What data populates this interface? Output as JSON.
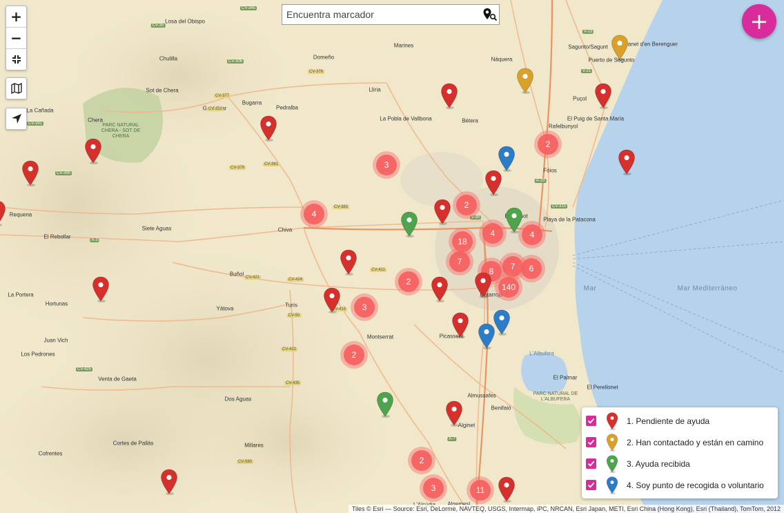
{
  "search": {
    "placeholder": "Encuentra marcador"
  },
  "controls": {
    "zoom_in": "+",
    "zoom_out": "−"
  },
  "fab_label": "+",
  "colors": {
    "red": "#d6302d",
    "orange": "#d9a12a",
    "green": "#4ea34d",
    "blue": "#2d7cc7",
    "accent": "#d82c9c",
    "cluster": "#f55f5f"
  },
  "legend": [
    {
      "label": "1. Pendiente de ayuda",
      "color": "red"
    },
    {
      "label": "2. Han contactado y están en camino",
      "color": "orange"
    },
    {
      "label": "3. Ayuda recibida",
      "color": "green"
    },
    {
      "label": "4. Soy punto de recogida o voluntario",
      "color": "blue"
    }
  ],
  "clusters": [
    {
      "label": "2",
      "place": "Massamagrell"
    },
    {
      "label": "3",
      "place": "Riba-roja de Túria"
    },
    {
      "label": "4",
      "place": "Chiva"
    },
    {
      "label": "2",
      "place": "Quart de Poblet"
    },
    {
      "label": "4",
      "place": "Burjassot"
    },
    {
      "label": "4",
      "place": "València"
    },
    {
      "label": "18",
      "place": "Torrent"
    },
    {
      "label": "7",
      "place": "Torrent"
    },
    {
      "label": "8",
      "place": "Paiporta"
    },
    {
      "label": "7",
      "place": "Sedaví"
    },
    {
      "label": "6",
      "place": "València sur"
    },
    {
      "label": "140",
      "place": "Catarroja"
    },
    {
      "label": "2",
      "place": "Alfarp"
    },
    {
      "label": "3",
      "place": "Turís"
    },
    {
      "label": "2",
      "place": "Montserrat"
    },
    {
      "label": "2",
      "place": "Alzira"
    },
    {
      "label": "3",
      "place": "L'Alcúdia"
    },
    {
      "label": "11",
      "place": "Algemesí"
    }
  ],
  "markers": [
    {
      "color": "red"
    },
    {
      "color": "orange"
    },
    {
      "color": "orange"
    },
    {
      "color": "red"
    },
    {
      "color": "red"
    },
    {
      "color": "red"
    },
    {
      "color": "red"
    },
    {
      "color": "red"
    },
    {
      "color": "red"
    },
    {
      "color": "blue"
    },
    {
      "color": "red"
    },
    {
      "color": "red"
    },
    {
      "color": "green"
    },
    {
      "color": "green"
    },
    {
      "color": "red"
    },
    {
      "color": "red"
    },
    {
      "color": "red"
    },
    {
      "color": "red"
    },
    {
      "color": "red"
    },
    {
      "color": "blue"
    },
    {
      "color": "blue"
    },
    {
      "color": "red"
    },
    {
      "color": "blue"
    },
    {
      "color": "green"
    },
    {
      "color": "red"
    },
    {
      "color": "red"
    },
    {
      "color": "red"
    }
  ],
  "places": [
    "Losa del Obispo",
    "Marines",
    "Domeño",
    "Náquera",
    "Chulilla",
    "Sot de Chera",
    "Gestalgar",
    "Bugarra",
    "Pedralba",
    "Llíria",
    "La Pobla de Vallbona",
    "Bétera",
    "Puçol",
    "El Puig de Santa María",
    "Rafelbunyol",
    "La Cañada",
    "Chera",
    "Fòios",
    "Burjassot",
    "Requena",
    "Siete Aguas",
    "Chiva",
    "El Rebollar",
    "Playa de la Patacona",
    "Buñol",
    "Turís",
    "Yátova",
    "La Portera",
    "Hortunas",
    "Juan Vich",
    "Los Pedrones",
    "Venta de Gaeta",
    "Montserrat",
    "Picassent",
    "Catarroja",
    "Dos Aguas",
    "Almussafes",
    "Benifaió",
    "Alginet",
    "Cortes de Pallás",
    "Cofrentes",
    "Millares",
    "El Palmar",
    "El Perellonet",
    "Sagunto/Sagunt",
    "Puerto de Sagunto",
    "Canet d'en Berenguer",
    "L'Alcúdia",
    "Algemesí"
  ],
  "sea": {
    "label": "Mar Mediterráneo"
  },
  "parks": [
    "PARC NATURAL CHERA - SOT DE CHERA",
    "PARC NATURAL DE L'ALBUFERA"
  ],
  "lake": "L'Albufera",
  "roads": [
    "CV-345",
    "CV-35",
    "CV-306",
    "CV-377",
    "CV-376",
    "CV-310",
    "CV-391",
    "CV-395",
    "CV-379",
    "CV-381",
    "CV-383",
    "A-3",
    "CV-411",
    "CV-421",
    "CV-424",
    "CV-425",
    "CV-415",
    "CV-50",
    "CV-422",
    "CV-435",
    "A-7",
    "V-21",
    "V-23",
    "V-30",
    "CV-315",
    "CV-590",
    "A-23"
  ],
  "attribution": "Tiles © Esri — Source: Esri, DeLorme, NAVTEQ, USGS, Intermap, iPC, NRCAN, Esri Japan, METI, Esri China (Hong Kong), Esri (Thailand), TomTom, 2012"
}
